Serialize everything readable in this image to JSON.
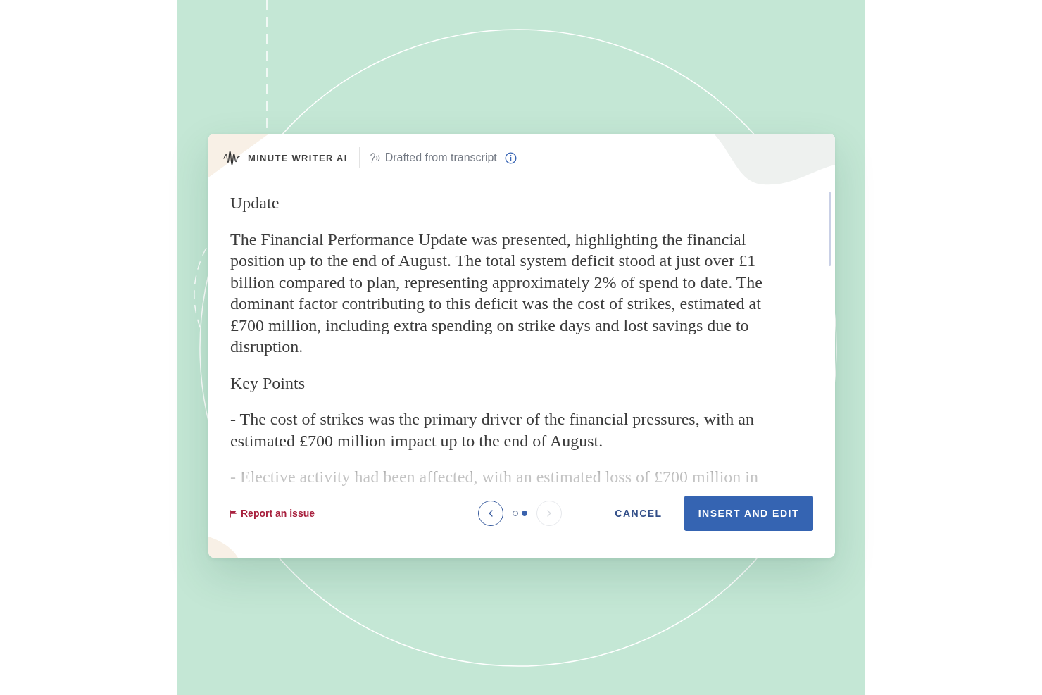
{
  "header": {
    "brand": "MINUTE WRITER AI",
    "source": "Drafted from transcript"
  },
  "sections": [
    {
      "heading": "Update",
      "paragraphs": [
        "The Financial Performance Update was presented, highlighting the financial position up to the end of August. The total system deficit stood at just over £1 billion compared to plan, representing approximately 2% of spend to date. The dominant factor contributing to this deficit was the cost of strikes, estimated at £700 million, including extra spending on strike days and lost savings due to disruption."
      ]
    },
    {
      "heading": "Key Points",
      "paragraphs": [
        "- The cost of strikes was the primary driver of the financial pressures, with an estimated £700 million impact up to the end of August.",
        "- Elective activity had been affected, with an estimated loss of £700 million in"
      ]
    }
  ],
  "footer": {
    "report_link": "Report an issue",
    "pager": {
      "prev": {
        "disabled": false
      },
      "pages": [
        {
          "selected": false
        },
        {
          "selected": true
        }
      ],
      "next": {
        "disabled": true
      }
    },
    "cancel": "CANCEL",
    "insert": "INSERT AND EDIT"
  }
}
